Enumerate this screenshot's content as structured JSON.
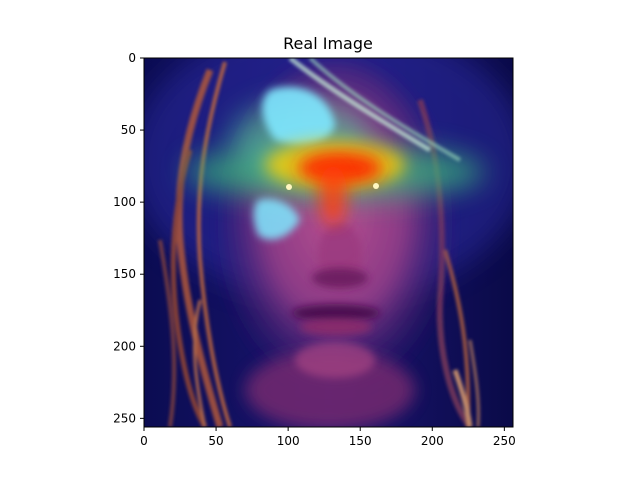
{
  "figure": {
    "title": "Real Image",
    "image": {
      "subject": "face-with-heatmap-overlay",
      "x_range": [
        0,
        256
      ],
      "y_range": [
        0,
        256
      ],
      "y_inverted": true,
      "colors": {
        "background_navy": "#0a0a4a",
        "heat_red": "#ff2200",
        "heat_yellow": "#ffcc00",
        "heat_green": "#3ab87a",
        "heat_cyan": "#7fe8ff",
        "skin_magenta": "#a0408a",
        "hair_orange": "#c06038"
      }
    },
    "x_ticks": [
      {
        "value": 0,
        "label": "0"
      },
      {
        "value": 50,
        "label": "50"
      },
      {
        "value": 100,
        "label": "100"
      },
      {
        "value": 150,
        "label": "150"
      },
      {
        "value": 200,
        "label": "200"
      },
      {
        "value": 250,
        "label": "250"
      }
    ],
    "y_ticks": [
      {
        "value": 0,
        "label": "0"
      },
      {
        "value": 50,
        "label": "50"
      },
      {
        "value": 100,
        "label": "100"
      },
      {
        "value": 150,
        "label": "150"
      },
      {
        "value": 200,
        "label": "200"
      },
      {
        "value": 250,
        "label": "250"
      }
    ]
  }
}
